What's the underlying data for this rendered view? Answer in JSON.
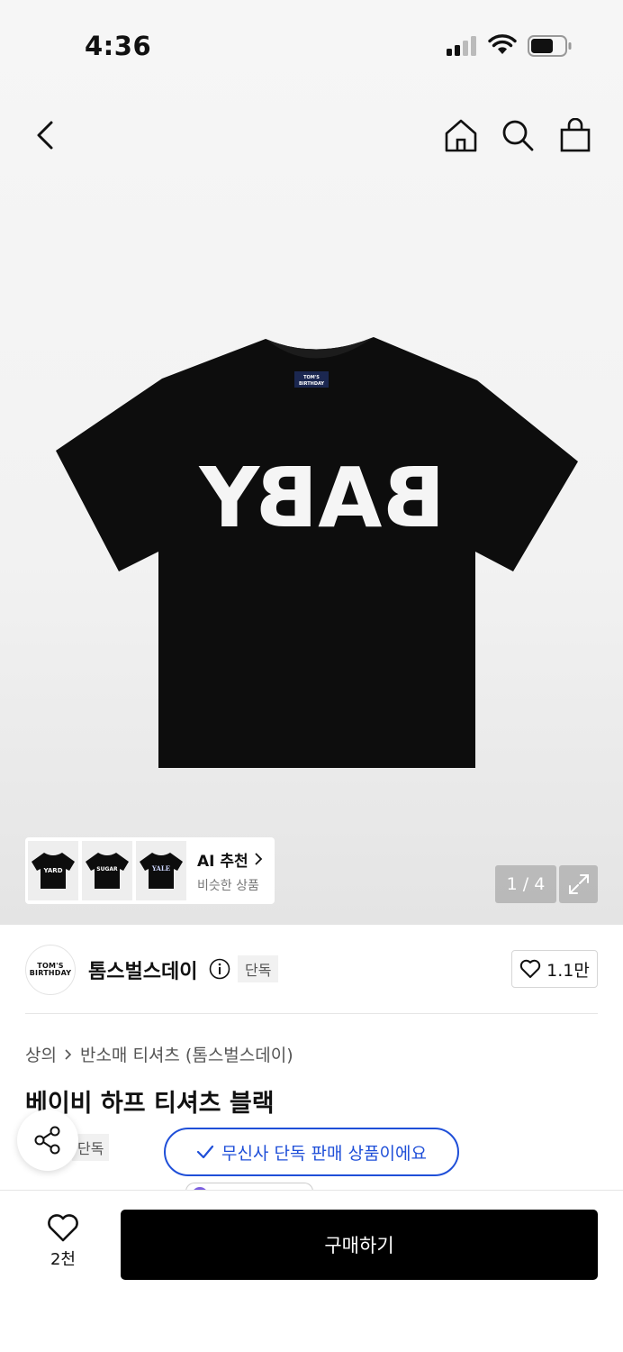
{
  "status_bar": {
    "time": "4:36"
  },
  "hero": {
    "shirt_print": "BABY",
    "neck_label": [
      "TOM'S",
      "BIRTHDAY"
    ],
    "ai_recommend": {
      "title": "AI 추천",
      "subtitle": "비슷한 상품",
      "thumbnails": [
        "YARD",
        "SUGAR",
        "YALE"
      ]
    },
    "image_counter": "1 / 4"
  },
  "brand": {
    "logo_lines": [
      "TOM'S",
      "BIRTHDAY"
    ],
    "name": "톰스벌스데이",
    "tag": "단독",
    "like_count": "1.1만"
  },
  "breadcrumb": {
    "category": "상의",
    "subcategory": "반소매 티셔츠 (톰스벌스데이)"
  },
  "product": {
    "title": "베이비 하프 티셔츠 블랙",
    "tag": "단독"
  },
  "toast": {
    "message": "무신사 단독 판매 상품이에요"
  },
  "bottom_bar": {
    "wish_count": "2천",
    "buy_label": "구매하기"
  },
  "colors": {
    "accent_blue": "#1f4fd8",
    "buy_button": "#000000"
  }
}
